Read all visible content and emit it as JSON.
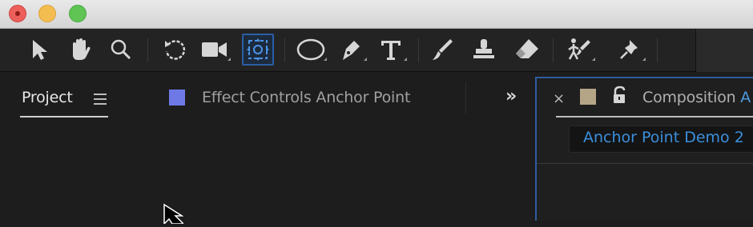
{
  "window": {
    "controls": [
      "close",
      "minimize",
      "zoom"
    ]
  },
  "toolbar": {
    "tools": [
      {
        "name": "selection-tool",
        "icon": "arrow-cursor-icon"
      },
      {
        "name": "hand-tool",
        "icon": "hand-icon"
      },
      {
        "name": "zoom-tool",
        "icon": "magnifier-icon"
      },
      {
        "name": "rotation-tool",
        "icon": "rotate-icon"
      },
      {
        "name": "camera-tool",
        "icon": "video-camera-icon"
      },
      {
        "name": "pan-behind-tool",
        "icon": "anchor-point-icon",
        "active": true
      },
      {
        "name": "ellipse-tool",
        "icon": "ellipse-icon"
      },
      {
        "name": "pen-tool",
        "icon": "pen-icon"
      },
      {
        "name": "type-tool",
        "icon": "type-icon"
      },
      {
        "name": "brush-tool",
        "icon": "brush-icon"
      },
      {
        "name": "clone-stamp-tool",
        "icon": "stamp-icon"
      },
      {
        "name": "eraser-tool",
        "icon": "eraser-icon"
      },
      {
        "name": "roto-brush-tool",
        "icon": "roto-brush-icon"
      },
      {
        "name": "puppet-pin-tool",
        "icon": "pin-icon"
      }
    ],
    "active_accent": "#2a5fa4"
  },
  "left_panel": {
    "tabs": [
      {
        "label": "Project",
        "active": true
      },
      {
        "label": "Effect Controls Anchor Point",
        "swatch": "#6e79e6",
        "active": false
      }
    ],
    "overflow_glyph": "»"
  },
  "right_panel": {
    "close_glyph": "×",
    "swatch": "#b5a587",
    "tab_label_prefix": "Composition ",
    "tab_label_accent": "A",
    "breadcrumb": "Anchor Point Demo 2",
    "accent_color": "#2d5d9f"
  }
}
